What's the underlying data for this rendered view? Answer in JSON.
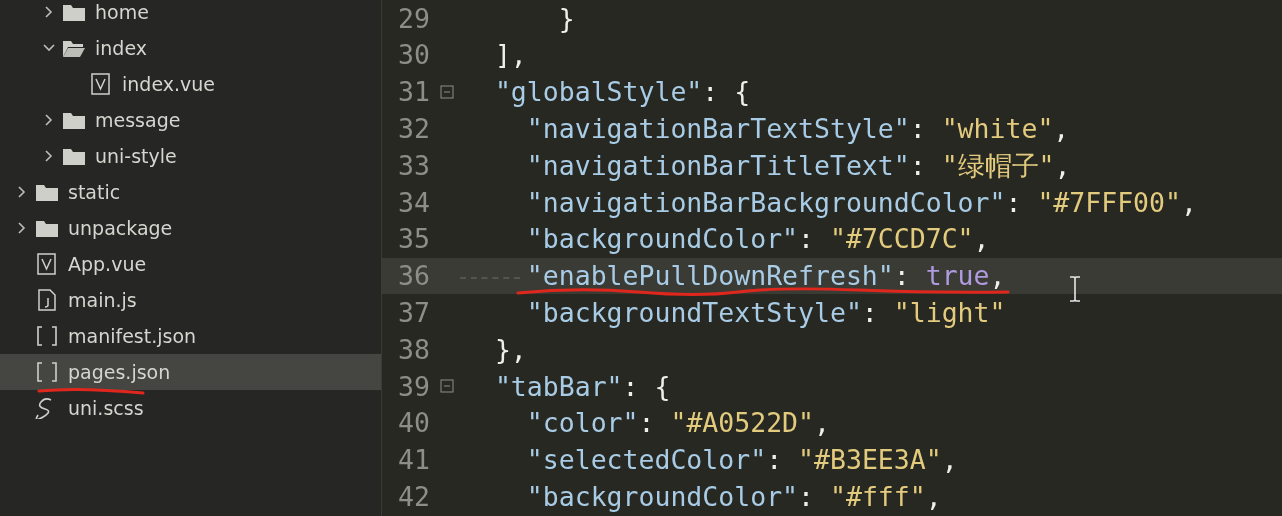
{
  "file_tree": [
    {
      "children": [
        {
          "label": "home",
          "kind": "folder",
          "expanded": false,
          "selected": false,
          "underlined": false
        },
        {
          "label": "index",
          "kind": "folder",
          "expanded": true,
          "selected": false,
          "underlined": false,
          "children": [
            {
              "label": "index.vue",
              "kind": "vue",
              "selected": false,
              "underlined": false
            }
          ]
        },
        {
          "label": "message",
          "kind": "folder",
          "expanded": false,
          "selected": false,
          "underlined": false
        },
        {
          "label": "uni-style",
          "kind": "folder",
          "expanded": false,
          "selected": false,
          "underlined": false
        }
      ]
    },
    {
      "label": "static",
      "kind": "folder",
      "expanded": false,
      "selected": false,
      "underlined": false
    },
    {
      "label": "unpackage",
      "kind": "folder",
      "expanded": false,
      "selected": false,
      "underlined": false
    },
    {
      "label": "App.vue",
      "kind": "vue",
      "selected": false,
      "underlined": false
    },
    {
      "label": "main.js",
      "kind": "js",
      "selected": false,
      "underlined": false
    },
    {
      "label": "manifest.json",
      "kind": "json",
      "selected": false,
      "underlined": false
    },
    {
      "label": "pages.json",
      "kind": "json",
      "selected": true,
      "underlined": true
    },
    {
      "label": "uni.scss",
      "kind": "scss",
      "selected": false,
      "underlined": false
    }
  ],
  "editor": {
    "lines": [
      {
        "number": "29",
        "foldable": false,
        "current": false,
        "underlined": false,
        "tokens": [
          {
            "kind": "punct",
            "text": "      }"
          }
        ]
      },
      {
        "number": "30",
        "foldable": false,
        "current": false,
        "underlined": false,
        "tokens": [
          {
            "kind": "punct",
            "text": "  ],"
          }
        ]
      },
      {
        "number": "31",
        "foldable": true,
        "current": false,
        "underlined": false,
        "tokens": [
          {
            "kind": "key",
            "text": "  \"globalStyle\""
          },
          {
            "kind": "punct",
            "text": ": {"
          }
        ]
      },
      {
        "number": "32",
        "foldable": false,
        "current": false,
        "underlined": false,
        "tokens": [
          {
            "kind": "key",
            "text": "    \"navigationBarTextStyle\""
          },
          {
            "kind": "punct",
            "text": ": "
          },
          {
            "kind": "string",
            "text": "\"white\""
          },
          {
            "kind": "punct",
            "text": ","
          }
        ]
      },
      {
        "number": "33",
        "foldable": false,
        "current": false,
        "underlined": false,
        "tokens": [
          {
            "kind": "key",
            "text": "    \"navigationBarTitleText\""
          },
          {
            "kind": "punct",
            "text": ": "
          },
          {
            "kind": "string",
            "text": "\"绿帽子\""
          },
          {
            "kind": "punct",
            "text": ","
          }
        ]
      },
      {
        "number": "34",
        "foldable": false,
        "current": false,
        "underlined": false,
        "tokens": [
          {
            "kind": "key",
            "text": "    \"navigationBarBackgroundColor\""
          },
          {
            "kind": "punct",
            "text": ": "
          },
          {
            "kind": "string",
            "text": "\"#7FFF00\""
          },
          {
            "kind": "punct",
            "text": ","
          }
        ]
      },
      {
        "number": "35",
        "foldable": false,
        "current": false,
        "underlined": false,
        "tokens": [
          {
            "kind": "key",
            "text": "    \"backgroundColor\""
          },
          {
            "kind": "punct",
            "text": ": "
          },
          {
            "kind": "string",
            "text": "\"#7CCD7C\""
          },
          {
            "kind": "punct",
            "text": ","
          }
        ]
      },
      {
        "number": "36",
        "foldable": false,
        "current": true,
        "underlined": true,
        "tokens": [
          {
            "kind": "key",
            "text": "    \"enablePullDownRefresh\""
          },
          {
            "kind": "punct",
            "text": ": "
          },
          {
            "kind": "bool",
            "text": "true"
          },
          {
            "kind": "punct",
            "text": ","
          }
        ]
      },
      {
        "number": "37",
        "foldable": false,
        "current": false,
        "underlined": false,
        "tokens": [
          {
            "kind": "key",
            "text": "    \"backgroundTextStyle\""
          },
          {
            "kind": "punct",
            "text": ": "
          },
          {
            "kind": "string",
            "text": "\"light\""
          }
        ]
      },
      {
        "number": "38",
        "foldable": false,
        "current": false,
        "underlined": false,
        "tokens": [
          {
            "kind": "punct",
            "text": "  },"
          }
        ]
      },
      {
        "number": "39",
        "foldable": true,
        "current": false,
        "underlined": false,
        "tokens": [
          {
            "kind": "key",
            "text": "  \"tabBar\""
          },
          {
            "kind": "punct",
            "text": ": {"
          }
        ]
      },
      {
        "number": "40",
        "foldable": false,
        "current": false,
        "underlined": false,
        "tokens": [
          {
            "kind": "key",
            "text": "    \"color\""
          },
          {
            "kind": "punct",
            "text": ": "
          },
          {
            "kind": "string",
            "text": "\"#A0522D\""
          },
          {
            "kind": "punct",
            "text": ","
          }
        ]
      },
      {
        "number": "41",
        "foldable": false,
        "current": false,
        "underlined": false,
        "tokens": [
          {
            "kind": "key",
            "text": "    \"selectedColor\""
          },
          {
            "kind": "punct",
            "text": ": "
          },
          {
            "kind": "string",
            "text": "\"#B3EE3A\""
          },
          {
            "kind": "punct",
            "text": ","
          }
        ]
      },
      {
        "number": "42",
        "foldable": false,
        "current": false,
        "underlined": false,
        "tokens": [
          {
            "kind": "key",
            "text": "    \"backgroundColor\""
          },
          {
            "kind": "punct",
            "text": ": "
          },
          {
            "kind": "string",
            "text": "\"#fff\""
          },
          {
            "kind": "punct",
            "text": ","
          }
        ]
      }
    ]
  }
}
